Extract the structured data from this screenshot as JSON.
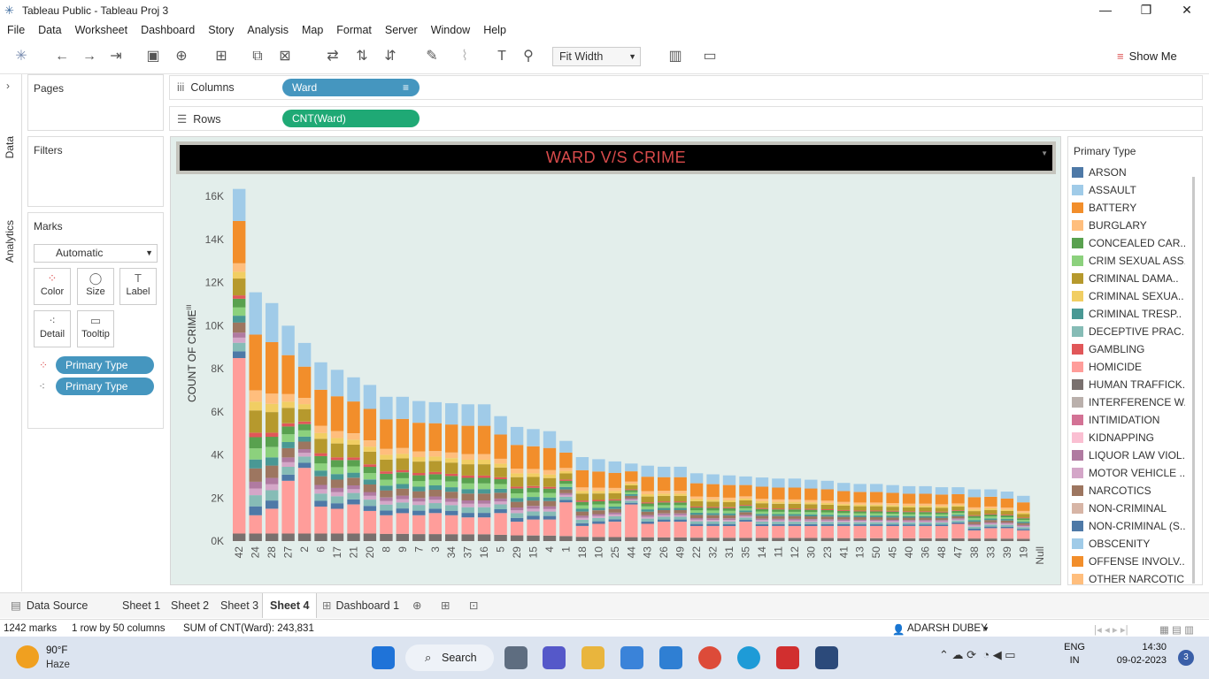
{
  "window": {
    "title": "Tableau Public - Tableau Proj 3",
    "minimize": "—",
    "maximize": "❐",
    "close": "✕"
  },
  "menu": [
    "File",
    "Data",
    "Worksheet",
    "Dashboard",
    "Story",
    "Analysis",
    "Map",
    "Format",
    "Server",
    "Window",
    "Help"
  ],
  "toolbar": {
    "fit_label": "Fit Width",
    "show_me": "Show Me"
  },
  "sidebar": {
    "data_tab": "Data",
    "analytics_tab": "Analytics"
  },
  "panels": {
    "pages": "Pages",
    "filters": "Filters",
    "marks": "Marks",
    "marks_type": "Automatic",
    "mark_buttons": [
      "Color",
      "Size",
      "Label",
      "Detail",
      "Tooltip"
    ],
    "mark_pills": [
      "Primary Type",
      "Primary Type"
    ]
  },
  "shelves": {
    "columns_label": "Columns",
    "columns_pill": "Ward",
    "rows_label": "Rows",
    "rows_pill": "CNT(Ward)"
  },
  "chart_title": "WARD V/S CRIME",
  "legend": {
    "title": "Primary Type",
    "items": [
      {
        "label": "ARSON",
        "color": "#4e79a7"
      },
      {
        "label": "ASSAULT",
        "color": "#a0cbe8"
      },
      {
        "label": "BATTERY",
        "color": "#f28e2b"
      },
      {
        "label": "BURGLARY",
        "color": "#ffbe7d"
      },
      {
        "label": "CONCEALED CAR..",
        "color": "#59a14f"
      },
      {
        "label": "CRIM SEXUAL ASS..",
        "color": "#8cd17d"
      },
      {
        "label": "CRIMINAL DAMA..",
        "color": "#b6992d"
      },
      {
        "label": "CRIMINAL SEXUA..",
        "color": "#f1ce63"
      },
      {
        "label": "CRIMINAL TRESP..",
        "color": "#499894"
      },
      {
        "label": "DECEPTIVE PRAC..",
        "color": "#86bcb6"
      },
      {
        "label": "GAMBLING",
        "color": "#e15759"
      },
      {
        "label": "HOMICIDE",
        "color": "#ff9d9a"
      },
      {
        "label": "HUMAN TRAFFICK..",
        "color": "#79706e"
      },
      {
        "label": "INTERFERENCE W..",
        "color": "#bab0ac"
      },
      {
        "label": "INTIMIDATION",
        "color": "#d37295"
      },
      {
        "label": "KIDNAPPING",
        "color": "#fabfd2"
      },
      {
        "label": "LIQUOR LAW VIOL..",
        "color": "#b07aa1"
      },
      {
        "label": "MOTOR VEHICLE ..",
        "color": "#d4a6c8"
      },
      {
        "label": "NARCOTICS",
        "color": "#9d7660"
      },
      {
        "label": "NON-CRIMINAL",
        "color": "#d7b5a6"
      },
      {
        "label": "NON-CRIMINAL (S..",
        "color": "#4e79a7"
      },
      {
        "label": "OBSCENITY",
        "color": "#a0cbe8"
      },
      {
        "label": "OFFENSE INVOLV..",
        "color": "#f28e2b"
      },
      {
        "label": "OTHER NARCOTIC..",
        "color": "#ffbe7d"
      }
    ]
  },
  "chart_data": {
    "type": "bar",
    "stacked": true,
    "ylabel": "COUNT OF CRIME",
    "xlabel": "",
    "ylim": [
      0,
      16500
    ],
    "y_ticks": [
      "0K",
      "2K",
      "4K",
      "6K",
      "8K",
      "10K",
      "12K",
      "14K",
      "16K"
    ],
    "categories": [
      "42",
      "24",
      "28",
      "27",
      "2",
      "6",
      "17",
      "21",
      "20",
      "8",
      "9",
      "7",
      "3",
      "34",
      "37",
      "16",
      "5",
      "29",
      "15",
      "4",
      "1",
      "18",
      "10",
      "25",
      "44",
      "43",
      "26",
      "49",
      "22",
      "32",
      "31",
      "35",
      "14",
      "11",
      "12",
      "30",
      "23",
      "41",
      "13",
      "50",
      "45",
      "40",
      "36",
      "48",
      "47",
      "38",
      "33",
      "39",
      "19",
      "Null"
    ],
    "values": [
      16350,
      11550,
      11050,
      10000,
      9200,
      8300,
      7950,
      7600,
      7250,
      6700,
      6700,
      6500,
      6450,
      6400,
      6350,
      6350,
      5800,
      5300,
      5200,
      5100,
      4650,
      3900,
      3800,
      3700,
      3600,
      3500,
      3450,
      3450,
      3150,
      3100,
      3050,
      3000,
      2950,
      2900,
      2900,
      2850,
      2800,
      2700,
      2650,
      2650,
      2600,
      2550,
      2550,
      2500,
      2500,
      2400,
      2400,
      2300,
      2100,
      0
    ],
    "homicide_segment": [
      8500,
      1200,
      1500,
      2800,
      3400,
      1600,
      1500,
      1700,
      1400,
      1200,
      1300,
      1200,
      1300,
      1200,
      1100,
      1100,
      1300,
      900,
      1000,
      1000,
      1800,
      700,
      800,
      900,
      1700,
      800,
      900,
      900,
      700,
      700,
      700,
      900,
      700,
      700,
      700,
      700,
      700,
      700,
      700,
      700,
      700,
      700,
      700,
      700,
      800,
      500,
      600,
      600,
      500,
      0
    ],
    "series_colors": [
      "#79706e",
      "#ff9d9a",
      "#4e79a7",
      "#86bcb6",
      "#d4a6c8",
      "#b07aa1",
      "#9d7660",
      "#499894",
      "#8cd17d",
      "#59a14f",
      "#e15759",
      "#b6992d",
      "#f1ce63",
      "#ffbe7d",
      "#f28e2b",
      "#a0cbe8"
    ]
  },
  "tabs": [
    "Data Source",
    "Sheet 1",
    "Sheet 2",
    "Sheet 3",
    "Sheet 4",
    "Dashboard 1"
  ],
  "active_tab": "Sheet 4",
  "status": {
    "marks": "1242 marks",
    "rows_cols": "1 row by 50 columns",
    "sum": "SUM of CNT(Ward): 243,831",
    "user": "ADARSH DUBEY"
  },
  "taskbar": {
    "temp": "90°F",
    "weather": "Haze",
    "search": "Search",
    "lang1": "ENG",
    "lang2": "IN",
    "time": "14:30",
    "date": "09-02-2023",
    "notif": "3"
  }
}
